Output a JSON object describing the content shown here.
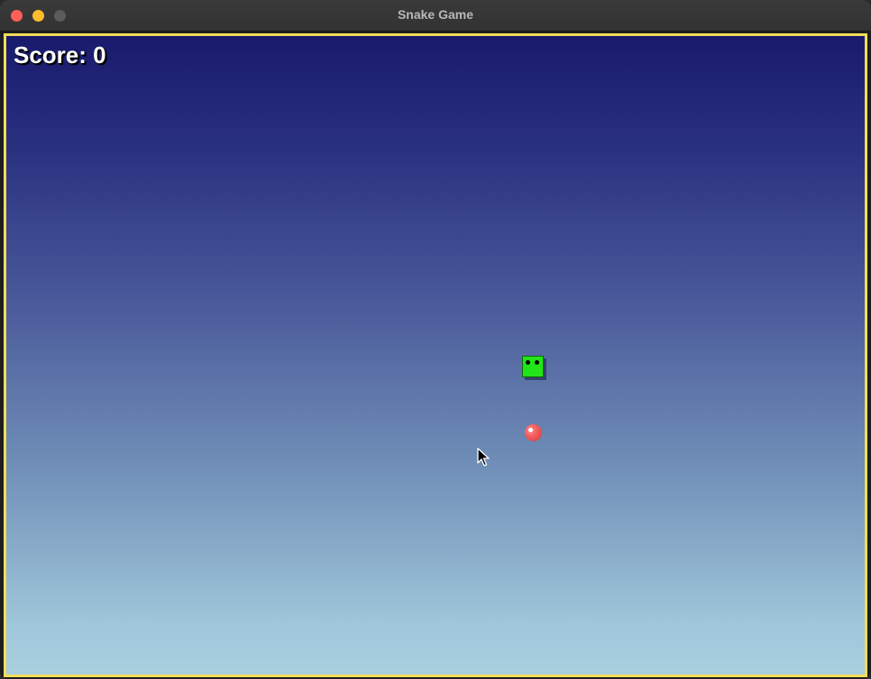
{
  "window": {
    "title": "Snake Game"
  },
  "hud": {
    "score_text": "Score: 0"
  },
  "colors": {
    "snake": "#22e418",
    "food": "#f25a5a",
    "border": "#f3dc5a",
    "sky_top": "#191a6c",
    "sky_bottom": "#a8d0de"
  },
  "icons": {
    "close": "close-dot-icon",
    "minimize": "minimize-dot-icon",
    "maximize": "maximize-dot-icon",
    "cursor": "mouse-pointer-icon"
  }
}
